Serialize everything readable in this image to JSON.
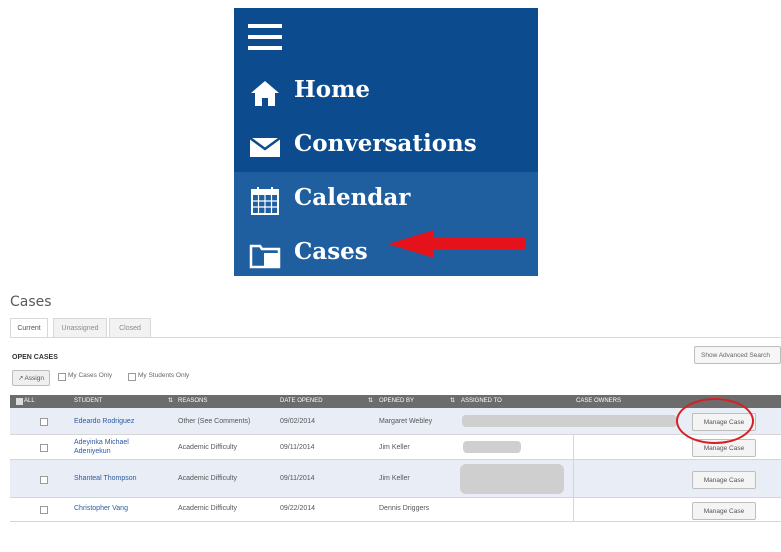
{
  "nav": {
    "items": [
      {
        "label": "Home",
        "icon": "home-icon"
      },
      {
        "label": "Conversations",
        "icon": "envelope-icon"
      },
      {
        "label": "Calendar",
        "icon": "calendar-icon"
      },
      {
        "label": "Cases",
        "icon": "folder-icon"
      }
    ],
    "colors": {
      "panel": "#0c4b8e",
      "selected": "#1f5fa0",
      "text": "#ffffff"
    },
    "annotation_color": "#d81e25"
  },
  "cases": {
    "title": "Cases",
    "tabs": [
      "Current",
      "Unassigned",
      "Closed"
    ],
    "section_heading": "OPEN CASES",
    "assign_label": "Assign",
    "filters": [
      "My Cases Only",
      "My Students Only"
    ],
    "advanced_search_label": "Show Advanced Search",
    "columns": [
      "ALL",
      "STUDENT",
      "REASONS",
      "DATE OPENED",
      "OPENED BY",
      "ASSIGNED TO",
      "CASE OWNERS"
    ],
    "manage_label": "Manage Case",
    "rows": [
      {
        "student": "Edeardo Rodriguez",
        "reason": "Other (See Comments)",
        "date": "09/02/2014",
        "opened_by": "Margaret Webley"
      },
      {
        "student": "Adeyinka Michael Adeniyekun",
        "reason": "Academic Difficulty",
        "date": "09/11/2014",
        "opened_by": "Jim Keller"
      },
      {
        "student": "Shanteal Thompson",
        "reason": "Academic Difficulty",
        "date": "09/11/2014",
        "opened_by": "Jim Keller"
      },
      {
        "student": "Christopher Vang",
        "reason": "Academic Difficulty",
        "date": "09/22/2014",
        "opened_by": "Dennis Driggers"
      }
    ]
  }
}
